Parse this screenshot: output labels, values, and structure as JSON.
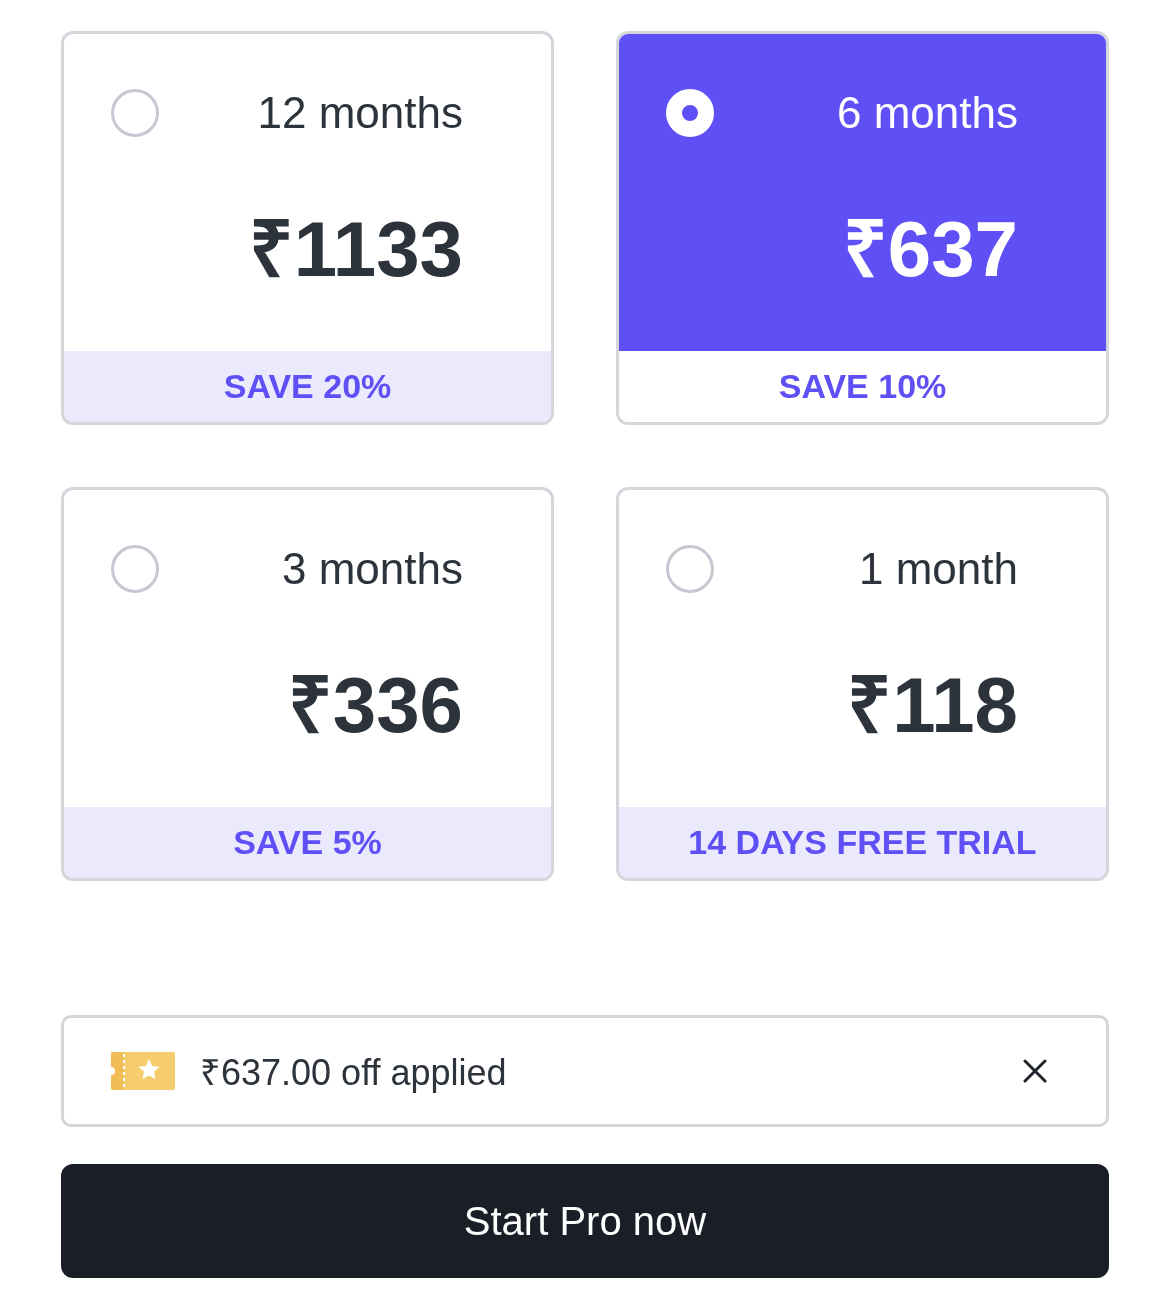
{
  "plans": [
    {
      "duration": "12 months",
      "price": "₹1133",
      "badge": "SAVE 20%",
      "selected": false
    },
    {
      "duration": "6 months",
      "price": "₹637",
      "badge": "SAVE 10%",
      "selected": true
    },
    {
      "duration": "3 months",
      "price": "₹336",
      "badge": "SAVE 5%",
      "selected": false
    },
    {
      "duration": "1 month",
      "price": "₹118",
      "badge": "14 DAYS FREE TRIAL",
      "selected": false
    }
  ],
  "coupon": {
    "text": "₹637.00 off applied"
  },
  "cta": {
    "label": "Start Pro now"
  }
}
